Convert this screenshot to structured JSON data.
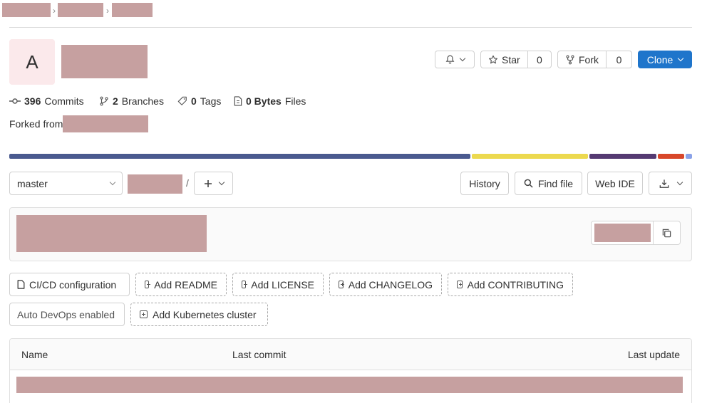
{
  "project": {
    "avatar_letter": "A",
    "notification": {
      "label": "Notifications"
    },
    "star": {
      "label": "Star",
      "count": "0"
    },
    "fork": {
      "label": "Fork",
      "count": "0"
    },
    "clone": {
      "label": "Clone"
    }
  },
  "stats": {
    "commits": {
      "value": "396",
      "label": "Commits"
    },
    "branches": {
      "value": "2",
      "label": "Branches"
    },
    "tags": {
      "value": "0",
      "label": "Tags"
    },
    "files": {
      "value": "0 Bytes",
      "label": "Files"
    }
  },
  "forked_from_label": "Forked from",
  "language_bar_colors": [
    "#4a5a8f",
    "#ecd94f",
    "#553a72",
    "#d8472a",
    "#8aa2e8"
  ],
  "toolbar": {
    "branch": "master",
    "path_sep": "/",
    "history": "History",
    "find_file": "Find file",
    "web_ide": "Web IDE"
  },
  "quick_actions": [
    "CI/CD configuration",
    "Add README",
    "Add LICENSE",
    "Add CHANGELOG",
    "Add CONTRIBUTING",
    "Auto DevOps enabled",
    "Add Kubernetes cluster"
  ],
  "file_table": {
    "columns": [
      "Name",
      "Last commit",
      "Last update"
    ]
  },
  "colors": {
    "accent": "#1f75cb",
    "avatar_bg": "#fbe9eb",
    "redaction": "#c6a0a0"
  }
}
